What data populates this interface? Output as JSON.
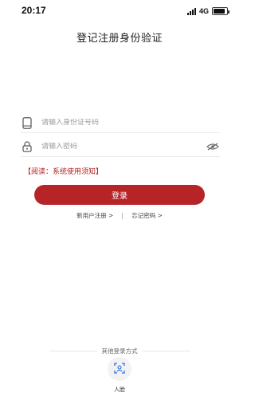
{
  "status_bar": {
    "time": "20:17",
    "network": "4G",
    "battery_level": 0.85
  },
  "title": "登记注册身份验证",
  "form": {
    "id_placeholder": "请输入身份证号码",
    "password_placeholder": "请输入密码",
    "notice": "【阅读：系统使用须知】"
  },
  "login_button": "登录",
  "links": {
    "register": "新用户注册 >",
    "forgot": "忘记密码 >"
  },
  "other_login": {
    "title": "其他登录方式",
    "face_label": "人脸"
  },
  "colors": {
    "accent": "#b72428",
    "notice": "#b51d1d"
  },
  "icons": [
    "phone-icon",
    "lock-icon",
    "eye-hidden-icon",
    "face-scan-icon"
  ]
}
